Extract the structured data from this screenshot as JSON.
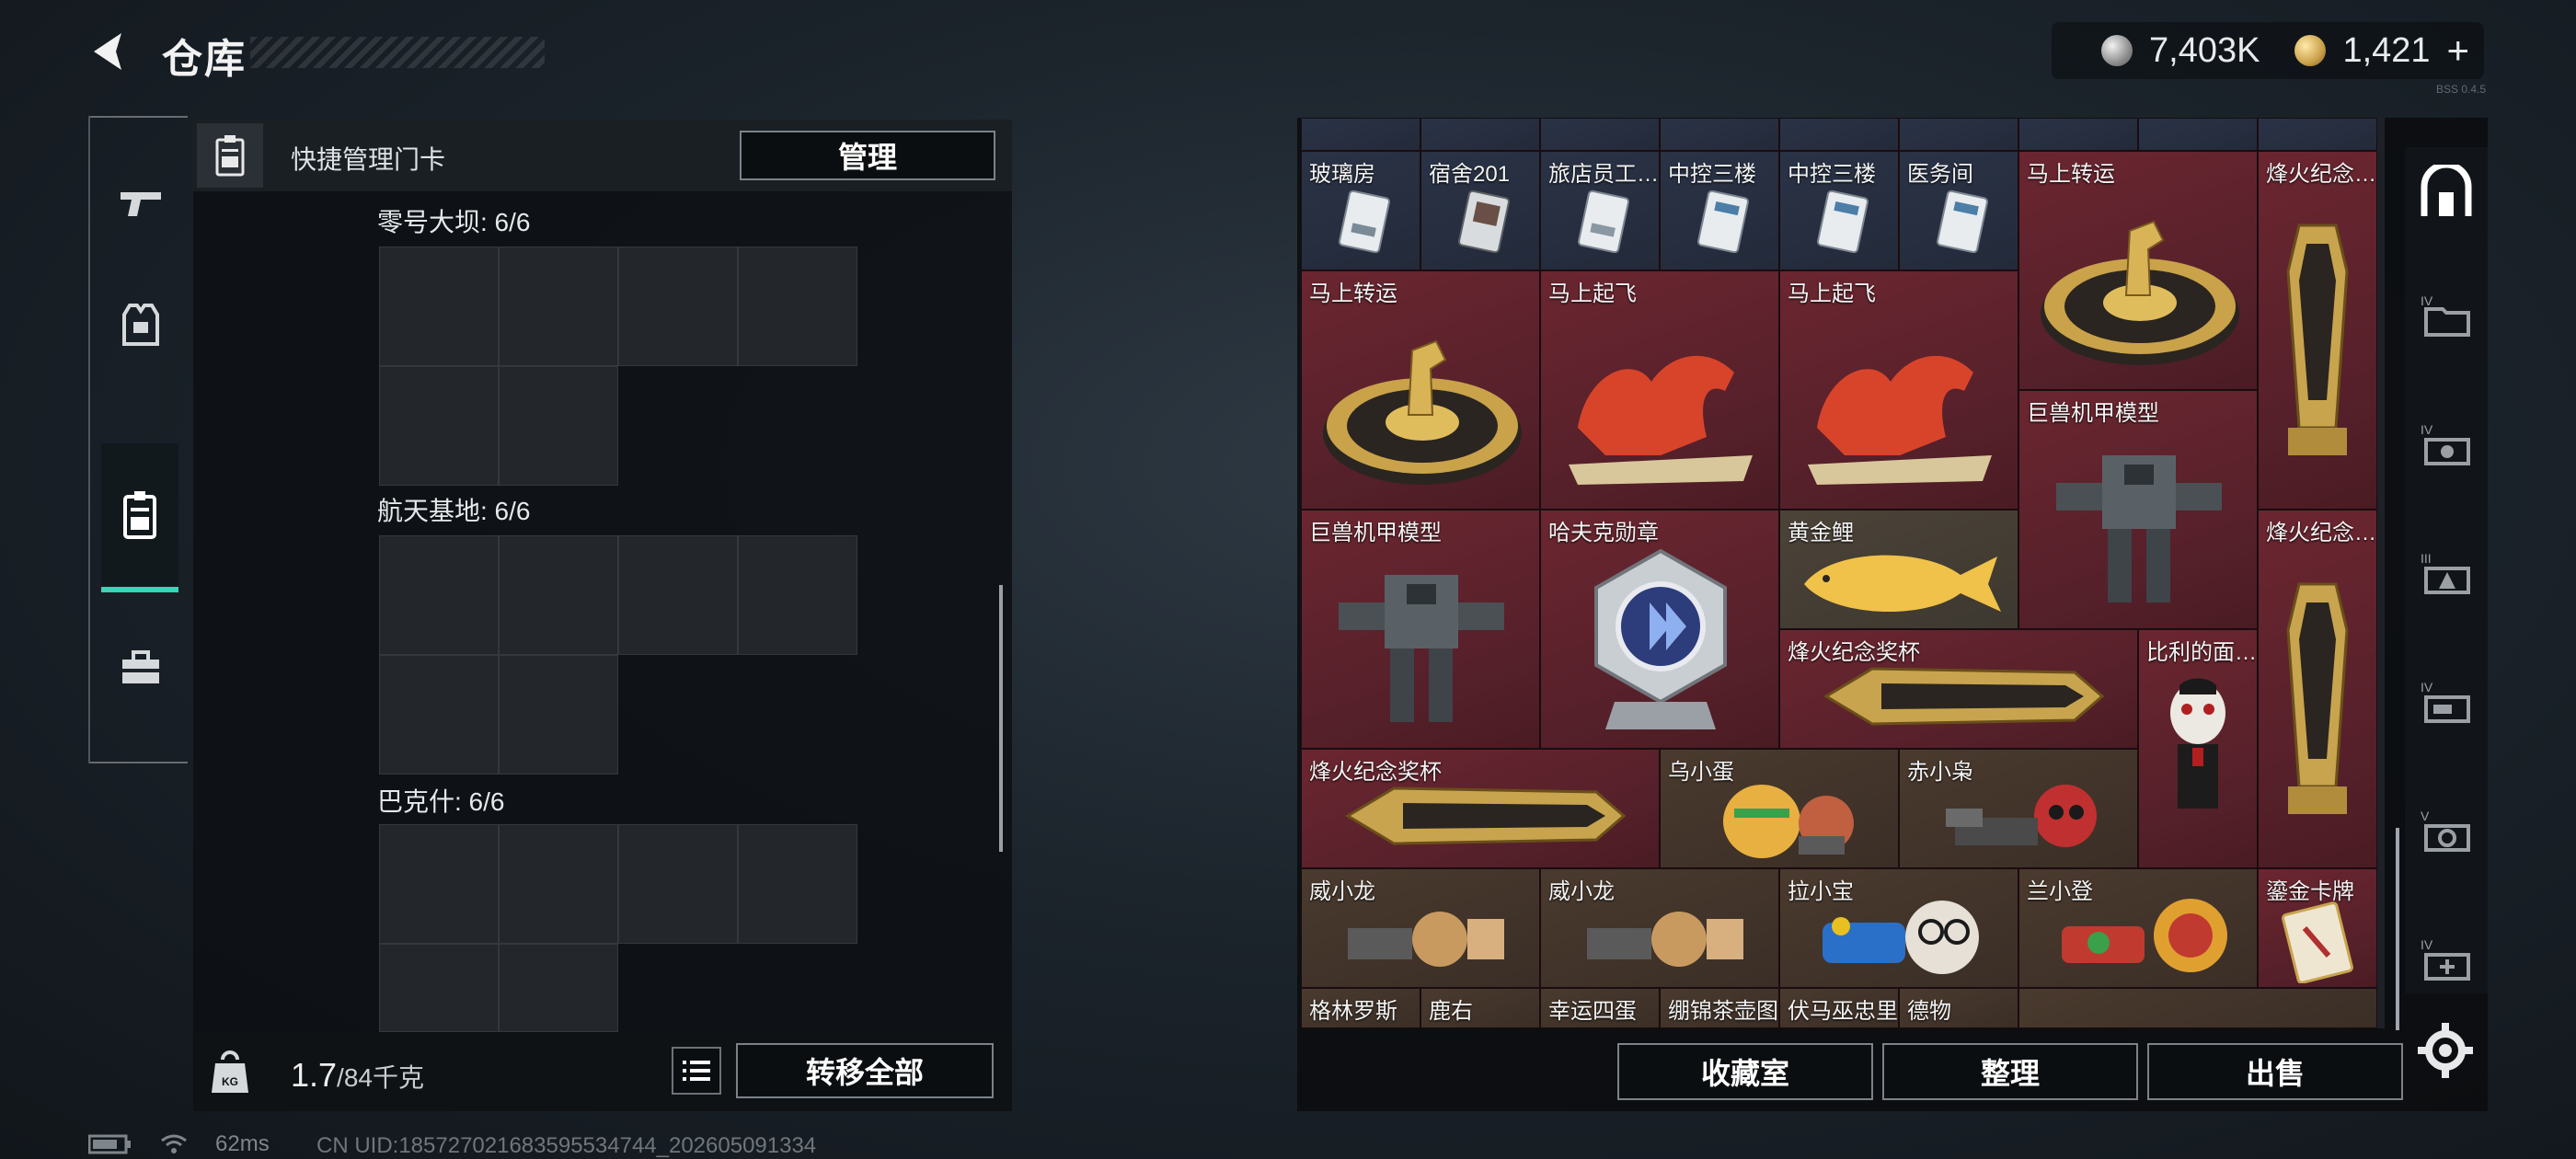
{
  "header": {
    "title": "仓库"
  },
  "currency": {
    "silver": "7,403K",
    "gold": "1,421",
    "add_label": "+"
  },
  "quick_manage": {
    "label": "快捷管理门卡",
    "manage_button": "管理"
  },
  "maps": [
    {
      "title": "零号大坝: 6/6"
    },
    {
      "title": "航天基地: 6/6"
    },
    {
      "title": "巴克什: 6/6"
    }
  ],
  "weight": {
    "current": "1.7",
    "capacity": "/84千克"
  },
  "transfer_all": "转移全部",
  "grid": {
    "top_keys": [
      "玻璃房",
      "宿舍201",
      "旅店员工…",
      "中控三楼",
      "中控三楼",
      "医务间"
    ],
    "items": [
      {
        "label": "马上转运",
        "icon": "horse-wheel-icon"
      },
      {
        "label": "烽火纪念…",
        "icon": "trophy-icon"
      },
      {
        "label": "马上转运",
        "icon": "horse-wheel-icon"
      },
      {
        "label": "马上起飞",
        "icon": "red-horse-icon"
      },
      {
        "label": "马上起飞",
        "icon": "red-horse-icon"
      },
      {
        "label": "巨兽机甲模型",
        "icon": "mech-icon"
      },
      {
        "label": "巨兽机甲模型",
        "icon": "mech-icon"
      },
      {
        "label": "哈夫克勋章",
        "icon": "medal-icon"
      },
      {
        "label": "黄金鲤",
        "icon": "golden-carp-icon"
      },
      {
        "label": "烽火纪念…",
        "icon": "trophy-icon"
      },
      {
        "label": "烽火纪念奖杯",
        "icon": "trophy-lying-icon"
      },
      {
        "label": "比利的面…",
        "icon": "puppet-mask-icon"
      },
      {
        "label": "烽火纪念奖杯",
        "icon": "trophy-lying-icon"
      },
      {
        "label": "乌小蛋",
        "icon": "figure-egg-icon"
      },
      {
        "label": "赤小枭",
        "icon": "figure-owl-icon"
      },
      {
        "label": "威小龙",
        "icon": "figure-dragon-icon"
      },
      {
        "label": "威小龙",
        "icon": "figure-dragon-icon"
      },
      {
        "label": "拉小宝",
        "icon": "figure-blue-icon"
      },
      {
        "label": "兰小登",
        "icon": "figure-red-icon"
      },
      {
        "label": "鎏金卡牌",
        "icon": "golden-card-icon"
      }
    ],
    "bottom_partial": [
      "格林罗斯",
      "鹿右",
      "幸运四蛋",
      "绷锦茶壶图",
      "伏马巫忠里",
      "德物"
    ]
  },
  "buttons": {
    "vault": "收藏室",
    "sort": "整理",
    "sell": "出售"
  },
  "status": {
    "ping": "62ms",
    "uid": "CN UID:185727021683595534744_202605091334",
    "version": "BSS 0.4.5"
  },
  "colors": {
    "accent": "#37d6b8",
    "rare_red": "#5a212b"
  }
}
